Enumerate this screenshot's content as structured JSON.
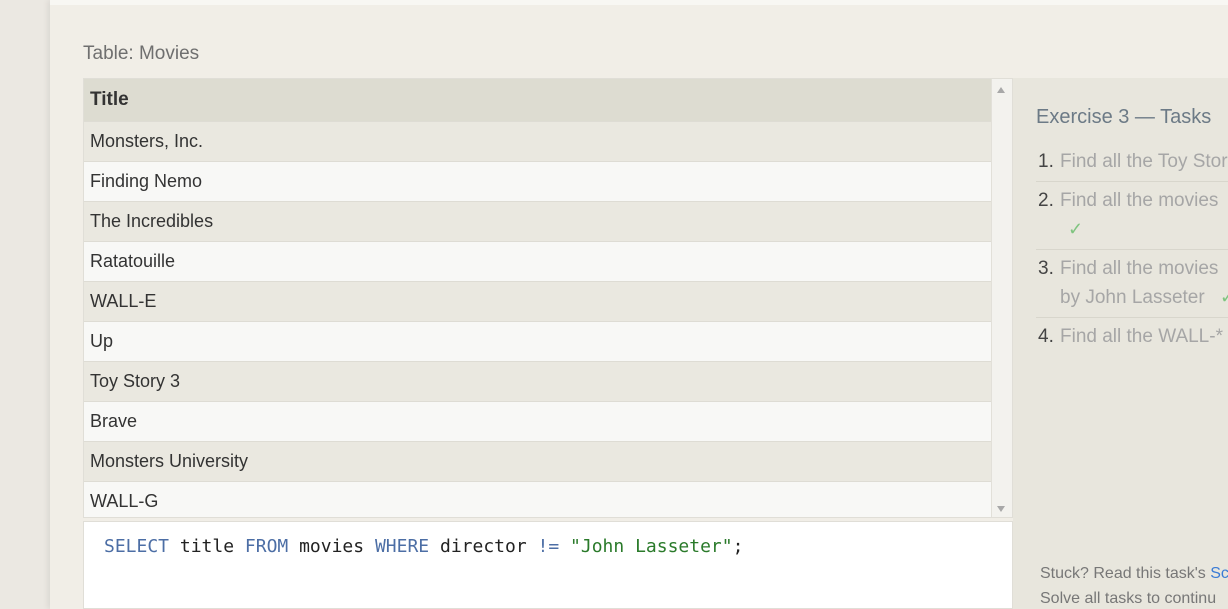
{
  "table_caption": "Table: Movies",
  "results": {
    "header": "Title",
    "rows": [
      "Monsters, Inc.",
      "Finding Nemo",
      "The Incredibles",
      "Ratatouille",
      "WALL-E",
      "Up",
      "Toy Story 3",
      "Brave",
      "Monsters University",
      "WALL-G"
    ]
  },
  "query": {
    "kw_select": "SELECT",
    "col": " title ",
    "kw_from": "FROM",
    "table": " movies ",
    "kw_where": "WHERE",
    "field": " director ",
    "op": "!=",
    "space": " ",
    "value": "\"John Lasseter\"",
    "end": ";"
  },
  "tasks": {
    "title": "Exercise 3 — Tasks",
    "items": [
      {
        "num": "1.",
        "line1": "Find all the Toy Stor",
        "line2": "",
        "check": ""
      },
      {
        "num": "2.",
        "line1": "Find all the movies",
        "line2": "",
        "check": "✓"
      },
      {
        "num": "3.",
        "line1": "Find all the movies",
        "line2": "by John Lasseter",
        "check": "✓"
      },
      {
        "num": "4.",
        "line1": "Find all the WALL-*",
        "line2": "",
        "check": ""
      }
    ],
    "stuck_prefix": "Stuck? Read this task's ",
    "stuck_link": "Sc",
    "solve_text": "Solve all tasks to continu"
  }
}
